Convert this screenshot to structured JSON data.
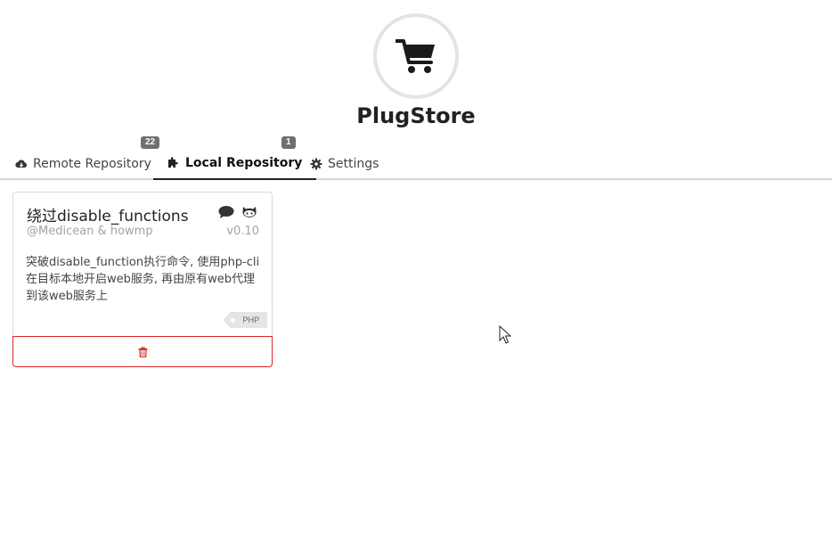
{
  "app": {
    "title": "PlugStore",
    "logo_icon": "shopping-cart-icon"
  },
  "tabs": [
    {
      "label": "Remote Repository",
      "icon": "cloud-download-icon",
      "badge": "22",
      "active": false
    },
    {
      "label": "Local Repository",
      "icon": "puzzle-icon",
      "badge": "1",
      "active": true
    },
    {
      "label": "Settings",
      "icon": "gear-icon",
      "badge": null,
      "active": false
    }
  ],
  "plugin": {
    "title": "绕过disable_functions",
    "author": "@Medicean & howmp",
    "version": "v0.10",
    "description": "突破disable_function执行命令, 使用php-cli在目标本地开启web服务, 再由原有web代理到该web服务上",
    "tag": "PHP",
    "icons": [
      "comment-icon",
      "github-icon"
    ],
    "delete_icon": "trash-icon"
  },
  "colors": {
    "accent": "#222222",
    "badge": "#6f6f6f",
    "danger": "#db2828"
  }
}
